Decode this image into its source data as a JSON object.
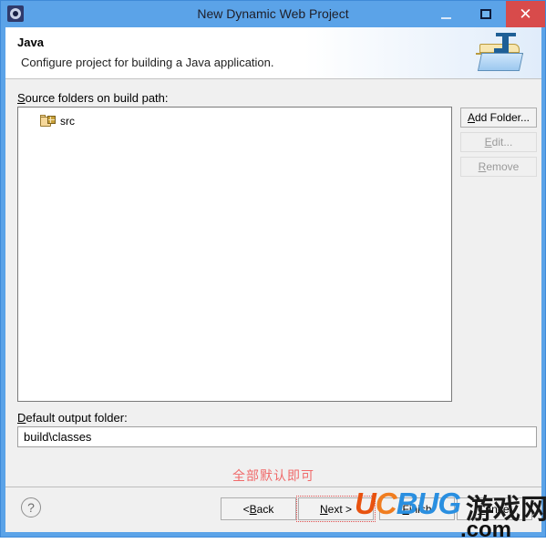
{
  "window": {
    "title": "New Dynamic Web Project",
    "icon": "eclipse-gear-icon",
    "controls": {
      "minimize": "minimize-icon",
      "maximize": "maximize-icon",
      "close": "close-icon"
    }
  },
  "header": {
    "title": "Java",
    "description": "Configure project for building a Java application.",
    "icon": "java-folder-icon"
  },
  "main": {
    "source_label_prefix": "S",
    "source_label_rest": "ource folders on build path:",
    "source_folders": [
      {
        "name": "src",
        "icon": "package-folder-icon"
      }
    ],
    "side_buttons": [
      {
        "id": "add-folder",
        "mnemonic": "A",
        "label_rest": "dd Folder...",
        "enabled": true
      },
      {
        "id": "edit",
        "mnemonic": "E",
        "label_rest": "dit...",
        "enabled": false
      },
      {
        "id": "remove",
        "mnemonic": "R",
        "label_rest": "emove",
        "enabled": false
      }
    ],
    "output_label_prefix": "D",
    "output_label_rest": "efault output folder:",
    "output_value": "build\\classes",
    "output_placeholder": "",
    "annotation": "全部默认即可",
    "annotation_color": "#f06a6a"
  },
  "footer": {
    "help_icon": "?",
    "buttons": [
      {
        "id": "back",
        "prefix": "< ",
        "mnemonic": "B",
        "rest": "ack",
        "highlighted": false
      },
      {
        "id": "next",
        "prefix": "",
        "mnemonic": "N",
        "rest": "ext >",
        "highlighted": true
      },
      {
        "id": "finish",
        "prefix": "",
        "mnemonic": "F",
        "rest": "inish",
        "highlighted": false
      },
      {
        "id": "cancel",
        "prefix": "",
        "mnemonic": "C",
        "rest": "ancel",
        "highlighted": false
      }
    ]
  },
  "watermark": {
    "u": "U",
    "c": "C",
    "b": "B",
    "u2": "U",
    "g": "G",
    "cn": "游戏网",
    "com": ".com"
  }
}
